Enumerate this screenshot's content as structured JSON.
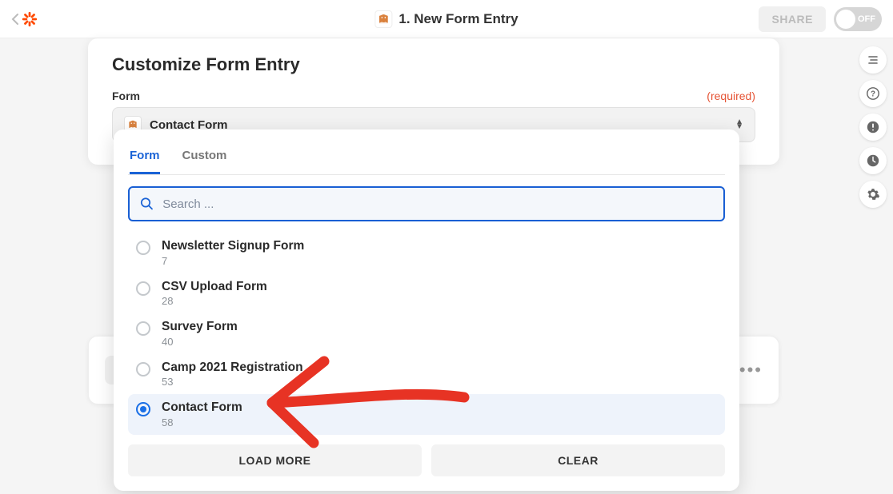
{
  "topbar": {
    "step_title": "1. New Form Entry",
    "share_label": "SHARE",
    "toggle_label": "OFF"
  },
  "card": {
    "heading": "Customize Form Entry",
    "field_label": "Form",
    "required_label": "(required)",
    "selected_value": "Contact Form"
  },
  "dropdown": {
    "tabs": {
      "form": "Form",
      "custom": "Custom"
    },
    "search_placeholder": "Search ...",
    "options": [
      {
        "label": "Newsletter Signup Form",
        "sub": "7",
        "selected": false
      },
      {
        "label": "CSV Upload Form",
        "sub": "28",
        "selected": false
      },
      {
        "label": "Survey Form",
        "sub": "40",
        "selected": false
      },
      {
        "label": "Camp 2021 Registration",
        "sub": "53",
        "selected": false
      },
      {
        "label": "Contact Form",
        "sub": "58",
        "selected": true
      }
    ],
    "load_more_label": "LOAD MORE",
    "clear_label": "CLEAR"
  },
  "colors": {
    "brand_orange": "#ff4a00",
    "link_blue": "#1a63d6",
    "required_red": "#e55334",
    "annotation_red": "#e73324"
  }
}
